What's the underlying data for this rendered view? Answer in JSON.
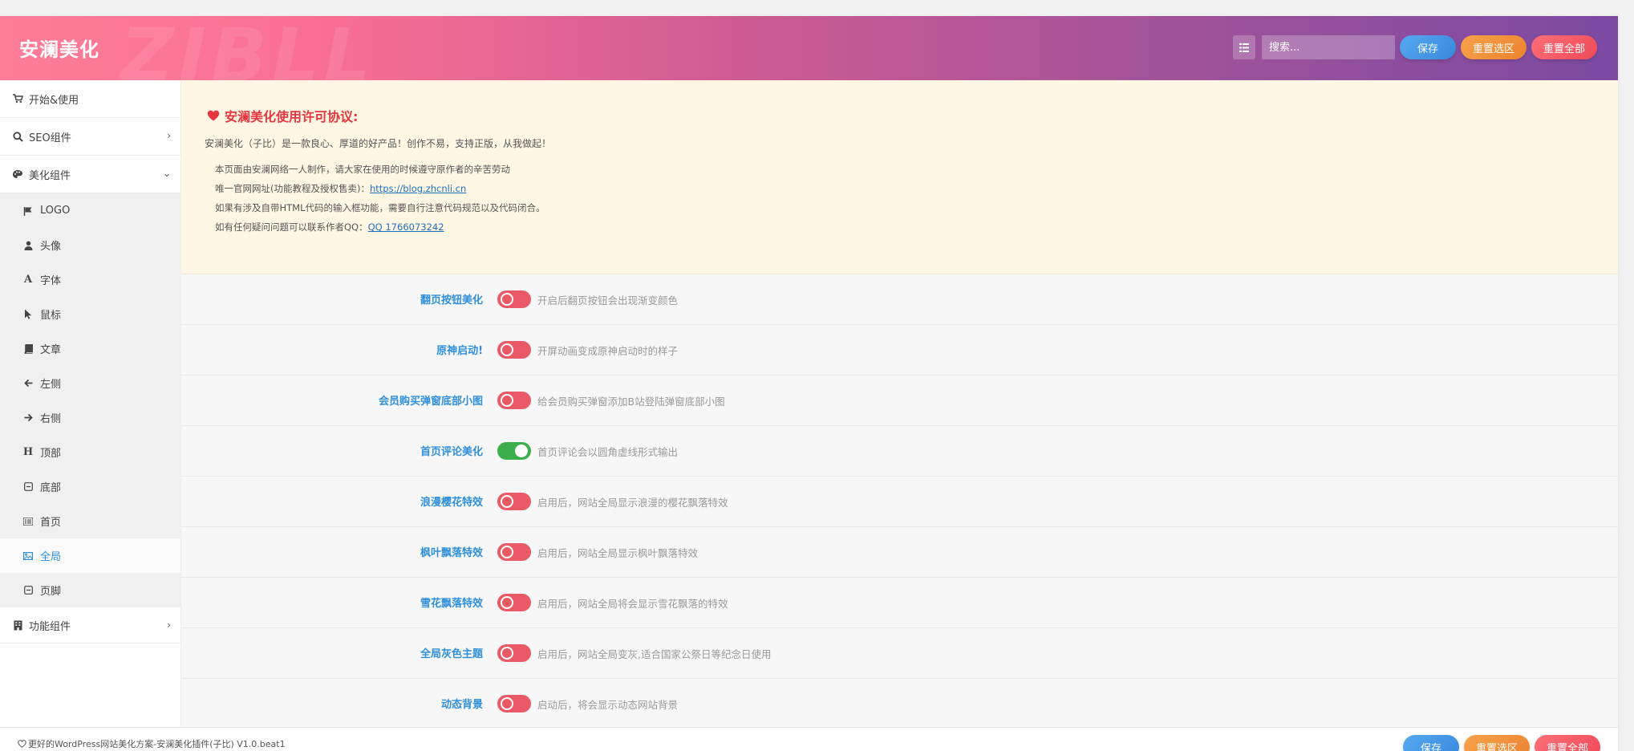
{
  "header": {
    "title": "安澜美化",
    "watermark": "ZIBLL",
    "search_placeholder": "搜索...",
    "save_label": "保存",
    "reset_section_label": "重置选区",
    "reset_all_label": "重置全部"
  },
  "sidebar": {
    "items": [
      {
        "label": "开始&使用",
        "icon": "cart-icon"
      },
      {
        "label": "SEO组件",
        "icon": "search-icon"
      },
      {
        "label": "美化组件",
        "icon": "palette-icon"
      }
    ],
    "sub_items": [
      {
        "label": "LOGO",
        "icon": "flag-icon"
      },
      {
        "label": "头像",
        "icon": "user-icon"
      },
      {
        "label": "字体",
        "icon": "font-icon"
      },
      {
        "label": "鼠标",
        "icon": "cursor-icon"
      },
      {
        "label": "文章",
        "icon": "book-icon"
      },
      {
        "label": "左侧",
        "icon": "arrow-left-icon"
      },
      {
        "label": "右侧",
        "icon": "arrow-right-icon"
      },
      {
        "label": "顶部",
        "icon": "heading-icon"
      },
      {
        "label": "底部",
        "icon": "square-icon"
      },
      {
        "label": "首页",
        "icon": "list-icon"
      },
      {
        "label": "全局",
        "icon": "image-icon"
      },
      {
        "label": "页脚",
        "icon": "square-icon"
      }
    ],
    "last_item": {
      "label": "功能组件",
      "icon": "building-icon"
    }
  },
  "notice": {
    "title": "安澜美化使用许可协议:",
    "lead": "安澜美化（子比）是一款良心、厚道的好产品！创作不易，支持正版，从我做起！",
    "line1": "本页面由安澜网络一人制作，请大家在使用的时候遵守原作者的辛苦劳动",
    "line2_prefix": "唯一官网网址(功能教程及授权售卖)：",
    "line2_link": "https://blog.zhcnli.cn",
    "line3": "如果有涉及自带HTML代码的输入框功能，需要自行注意代码规范以及代码闭合。",
    "line4_prefix": "如有任何疑问问题可以联系作者QQ：",
    "line4_link": "QQ 1766073242"
  },
  "settings": [
    {
      "label": "翻页按钮美化",
      "desc": "开启后翻页按钮会出现渐变颜色",
      "on": false
    },
    {
      "label": "原神启动!",
      "desc": "开屏动画变成原神启动时的样子",
      "on": false
    },
    {
      "label": "会员购买弹窗底部小图",
      "desc": "给会员购买弹窗添加B站登陆弹窗底部小图",
      "on": false
    },
    {
      "label": "首页评论美化",
      "desc": "首页评论会以圆角虚线形式输出",
      "on": true
    },
    {
      "label": "浪漫樱花特效",
      "desc": "启用后，网站全局显示浪漫的樱花飘落特效",
      "on": false
    },
    {
      "label": "枫叶飘落特效",
      "desc": "启用后，网站全局显示枫叶飘落特效",
      "on": false
    },
    {
      "label": "雪花飘落特效",
      "desc": "启用后，网站全局将会显示雪花飘落的特效",
      "on": false
    },
    {
      "label": "全局灰色主题",
      "desc": "启用后，网站全局变灰,适合国家公祭日等纪念日使用",
      "on": false
    },
    {
      "label": "动态背景",
      "desc": "启动后，将会显示动态网站背景",
      "on": false
    }
  ],
  "footer": {
    "text": "更好的WordPress网站美化方案-安澜美化插件(子比) V1.0.beat1",
    "save_label": "保存",
    "reset_section_label": "重置选区",
    "reset_all_label": "重置全部"
  },
  "colors": {
    "accent_blue": "#2f8fdb",
    "toggle_off": "#ea5a66",
    "toggle_on": "#3dae4c",
    "notice_bg": "#fff7e4",
    "notice_title": "#e6363f"
  }
}
